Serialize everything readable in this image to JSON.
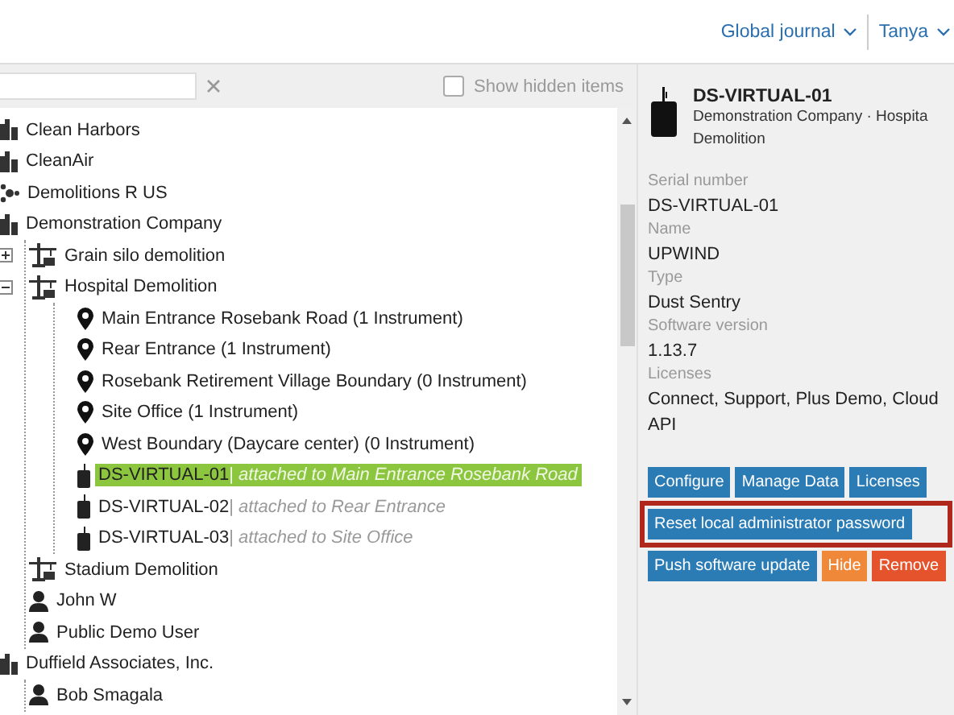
{
  "header": {
    "menus": [
      {
        "label": "Global journal"
      },
      {
        "label": "Tanya"
      }
    ]
  },
  "toolbar": {
    "show_hidden": {
      "label": "Show hidden items",
      "checked": false
    }
  },
  "tree": [
    {
      "kind": "company",
      "label": "Clean Harbors",
      "selected": false
    },
    {
      "kind": "company",
      "label": "CleanAir",
      "selected": false
    },
    {
      "kind": "group",
      "label": "Demolitions R US",
      "selected": false
    },
    {
      "kind": "company",
      "label": "Demonstration Company",
      "selected": false,
      "children": [
        {
          "kind": "site",
          "label": "Grain silo demolition",
          "selected": false,
          "expanded": false
        },
        {
          "kind": "site",
          "label": "Hospital Demolition",
          "selected": false,
          "expanded": true,
          "children": [
            {
              "kind": "location",
              "label": "Main Entrance Rosebank Road (1 Instrument)",
              "selected": false
            },
            {
              "kind": "location",
              "label": "Rear Entrance (1 Instrument)",
              "selected": false
            },
            {
              "kind": "location",
              "label": "Rosebank Retirement Village Boundary (0 Instrument)",
              "selected": false
            },
            {
              "kind": "location",
              "label": "Site Office (1 Instrument)",
              "selected": false
            },
            {
              "kind": "location",
              "label": "West Boundary (Daycare center) (0 Instrument)",
              "selected": false
            },
            {
              "kind": "instrument",
              "label": "DS-VIRTUAL-01",
              "separator": "|",
              "note": "attached to Main Entrance Rosebank Road",
              "selected": true
            },
            {
              "kind": "instrument",
              "label": "DS-VIRTUAL-02",
              "separator": "|",
              "note": "attached to Rear Entrance",
              "selected": false
            },
            {
              "kind": "instrument",
              "label": "DS-VIRTUAL-03",
              "separator": "|",
              "note": "attached to Site Office",
              "selected": false
            }
          ]
        },
        {
          "kind": "site",
          "label": "Stadium Demolition",
          "selected": false
        },
        {
          "kind": "user",
          "label": "John W",
          "selected": false
        },
        {
          "kind": "user",
          "label": "Public Demo User",
          "selected": false
        }
      ]
    },
    {
      "kind": "company",
      "label": "Duffield Associates, Inc.",
      "selected": false,
      "children": [
        {
          "kind": "user",
          "label": "Bob Smagala",
          "selected": false
        }
      ]
    }
  ],
  "details": {
    "title": "DS-VIRTUAL-01",
    "subtitle_lines": [
      "Demonstration Company · Hospita",
      "Demolition"
    ],
    "fields": [
      {
        "label": "Serial number",
        "value": "DS-VIRTUAL-01"
      },
      {
        "label": "Name",
        "value": "UPWIND"
      },
      {
        "label": "Type",
        "value": "Dust Sentry"
      },
      {
        "label": "Software version",
        "value": "1.13.7"
      },
      {
        "label": "Licenses",
        "value": "Connect, Support, Plus Demo, Cloud API"
      }
    ],
    "button_rows": [
      {
        "highlighted": false,
        "buttons": [
          {
            "label": "Configure",
            "kind": "primary"
          },
          {
            "label": "Manage Data",
            "kind": "primary"
          },
          {
            "label": "Licenses",
            "kind": "primary"
          }
        ]
      },
      {
        "highlighted": true,
        "buttons": [
          {
            "label": "Reset local administrator password",
            "kind": "primary"
          }
        ]
      },
      {
        "highlighted": false,
        "buttons": [
          {
            "label": "Push software update",
            "kind": "primary"
          },
          {
            "label": "Hide",
            "kind": "warning"
          },
          {
            "label": "Remove",
            "kind": "danger"
          }
        ]
      }
    ]
  }
}
